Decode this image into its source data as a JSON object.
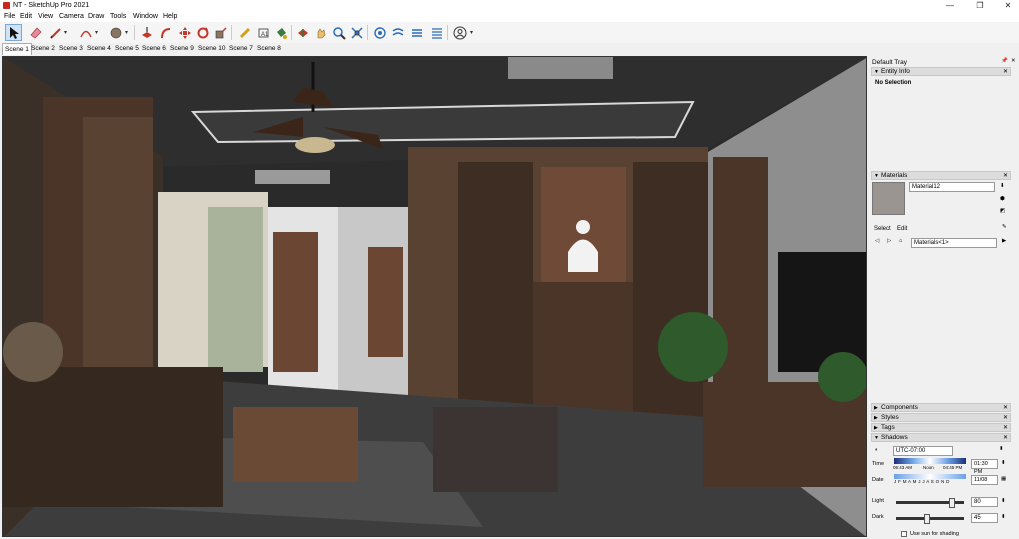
{
  "window": {
    "title": "NT - SketchUp Pro 2021",
    "minimize": "—",
    "restore": "❐",
    "close": "✕"
  },
  "menu": [
    "File",
    "Edit",
    "View",
    "Camera",
    "Draw",
    "Tools",
    "Window",
    "Help"
  ],
  "toolbar_icons": [
    "select",
    "eraser",
    "pencil",
    "arc",
    "paint-bucket",
    "push-pull",
    "follow-me",
    "move",
    "rotate",
    "scale",
    "tape-measure",
    "text",
    "paint",
    "orbit",
    "pan",
    "zoom",
    "zoom-extents",
    "position-camera",
    "look-around",
    "walk",
    "section-plane",
    "account"
  ],
  "scenes": [
    "Scene 1",
    "Scene 2",
    "Scene 3",
    "Scene 4",
    "Scene 5",
    "Scene 6",
    "Scene 9",
    "Scene 10",
    "Scene 7",
    "Scene 8"
  ],
  "tray": {
    "title": "Default Tray",
    "entity_info": {
      "header": "Entity Info",
      "selection": "No Selection"
    },
    "materials": {
      "header": "Materials",
      "name": "Material12",
      "tab_select": "Select",
      "tab_edit": "Edit",
      "library": "Materials<1>"
    },
    "collapsed": [
      "Components",
      "Styles",
      "Tags"
    ],
    "shadows": {
      "header": "Shadows",
      "timezone": "UTC-07:00",
      "time_label": "Time",
      "time_start": "05:43 AM",
      "time_noon": "Noon",
      "time_end": "04:45 PM",
      "time_value": "01:30 PM",
      "date_label": "Date",
      "months": "J F M A M J J A S O N D",
      "date_value": "11/08",
      "light_label": "Light",
      "light_value": "80",
      "dark_label": "Dark",
      "dark_value": "45",
      "sun_checkbox": "Use sun for shading"
    }
  },
  "colors": {
    "accent": "#2b6cb8",
    "wood_dark": "#4a3528",
    "wood_mid": "#6b4c38",
    "ceiling": "#2d2d2d",
    "floor": "#3b3b3b"
  }
}
